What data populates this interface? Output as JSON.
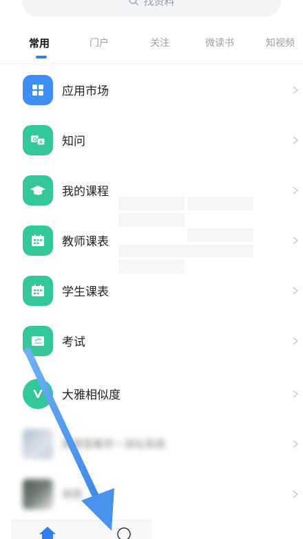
{
  "search": {
    "placeholder": "找资料"
  },
  "tabs": [
    {
      "label": "常用",
      "active": true
    },
    {
      "label": "门户"
    },
    {
      "label": "关注"
    },
    {
      "label": "微读书"
    },
    {
      "label": "知视频"
    }
  ],
  "apps": [
    {
      "label": "应用市场",
      "icon": "grid-icon",
      "color": "#3d8ff5"
    },
    {
      "label": "知问",
      "icon": "qa-icon",
      "color": "#34c79a"
    },
    {
      "label": "我的课程",
      "icon": "graduation-cap-icon",
      "color": "#34c79a"
    },
    {
      "label": "教师课表",
      "icon": "calendar-icon",
      "color": "#34c79a"
    },
    {
      "label": "学生课表",
      "icon": "calendar-icon",
      "color": "#34c79a"
    },
    {
      "label": "考试",
      "icon": "exam-icon",
      "color": "#34c79a"
    },
    {
      "label": "大雅相似度",
      "icon": "daya-logo-icon",
      "color": "#34c79a"
    }
  ],
  "blurred_items": [
    {
      "label": "新营营春学一消化系统"
    },
    {
      "label": "体质"
    }
  ],
  "colors": {
    "accent": "#2f80ed",
    "app_green": "#34c79a",
    "app_blue": "#3d8ff5",
    "arrow": "#5b9ff0"
  }
}
